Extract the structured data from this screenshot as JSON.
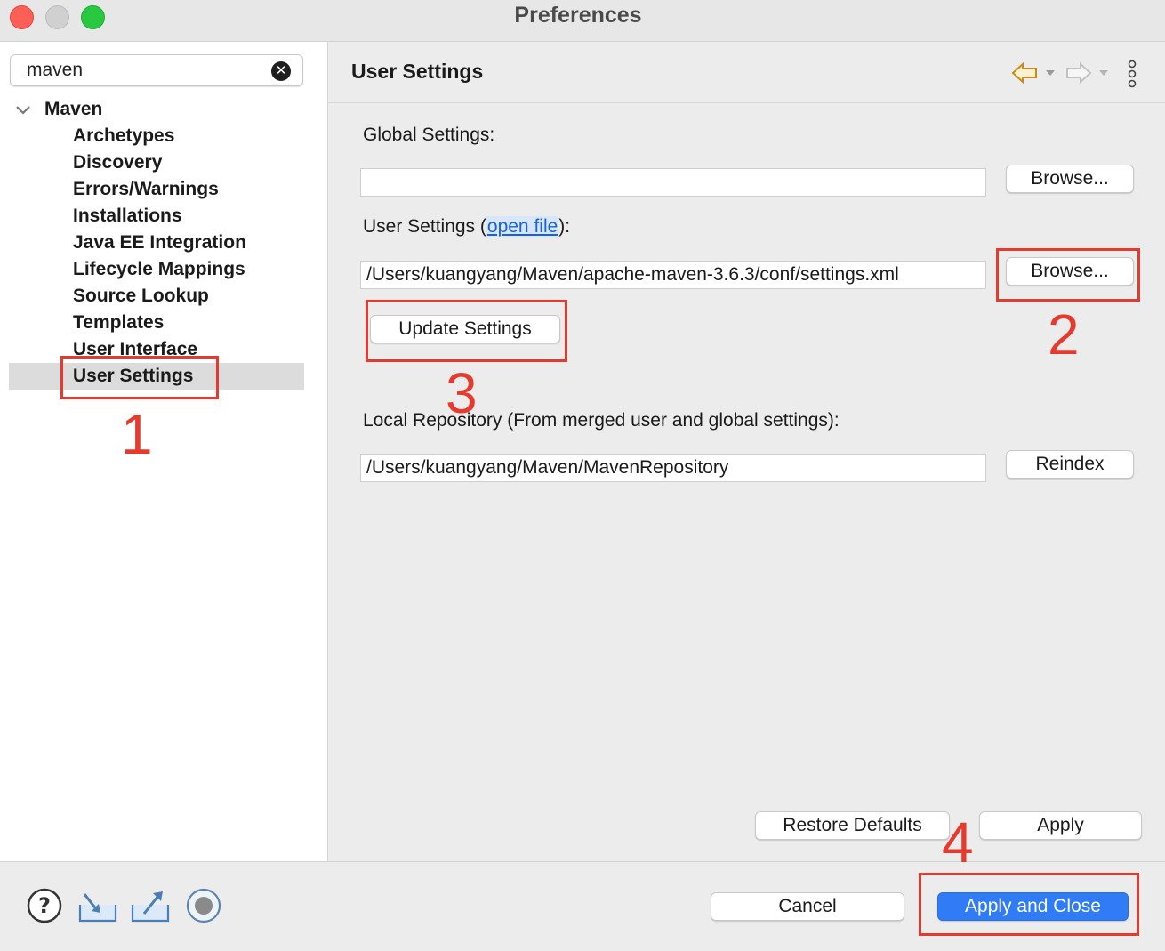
{
  "window": {
    "title": "Preferences"
  },
  "sidebar": {
    "search": {
      "value": "maven",
      "placeholder": ""
    },
    "root": "Maven",
    "items": [
      {
        "label": "Archetypes"
      },
      {
        "label": "Discovery"
      },
      {
        "label": "Errors/Warnings"
      },
      {
        "label": "Installations"
      },
      {
        "label": "Java EE Integration"
      },
      {
        "label": "Lifecycle Mappings"
      },
      {
        "label": "Source Lookup"
      },
      {
        "label": "Templates"
      },
      {
        "label": "User Interface"
      },
      {
        "label": "User Settings",
        "selected": true
      }
    ]
  },
  "main": {
    "title": "User Settings",
    "global_label": "Global Settings:",
    "global_value": "",
    "global_browse": "Browse...",
    "user_label_prefix": "User Settings (",
    "user_link": "open file",
    "user_label_suffix": "):",
    "user_value": "/Users/kuangyang/Maven/apache-maven-3.6.3/conf/settings.xml",
    "user_browse": "Browse...",
    "update_button": "Update Settings",
    "local_label": "Local Repository (From merged user and global settings):",
    "local_value": "/Users/kuangyang/Maven/MavenRepository",
    "reindex_button": "Reindex",
    "restore_button": "Restore Defaults",
    "apply_button": "Apply"
  },
  "footer": {
    "cancel_button": "Cancel",
    "apply_close_button": "Apply and Close"
  },
  "annotations": [
    "1",
    "2",
    "3",
    "4"
  ],
  "colors": {
    "accent": "#2f7cf6",
    "annotation": "#e53b2f",
    "link": "#1a63d6"
  }
}
